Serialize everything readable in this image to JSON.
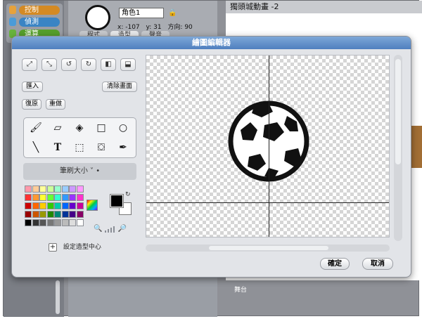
{
  "background": {
    "categories": [
      {
        "label": "控制",
        "color": "#e6a23c"
      },
      {
        "label": "偵測",
        "color": "#4b9bd8"
      },
      {
        "label": "運算",
        "color": "#68b43c"
      }
    ],
    "sprite_name": "角色1",
    "sprite_x": "x: -107",
    "sprite_y": "y: 31",
    "sprite_direction": "方向: 90",
    "tabs": [
      "程式",
      "造型",
      "聲音"
    ],
    "stage_title": "獨頭城動畫 -2",
    "stage_label": "舞台"
  },
  "editor": {
    "title": "繪圖編輯器",
    "import_label": "匯入",
    "clear_label": "清除畫面",
    "undo_label": "復原",
    "redo_label": "重做",
    "brush_size_label": "筆刷大小",
    "set_center_label": "設定造型中心",
    "ok_label": "確定",
    "cancel_label": "取消",
    "transform_icons": [
      "grow-icon",
      "shrink-icon",
      "rotate-left-icon",
      "rotate-right-icon",
      "flip-horizontal-icon",
      "flip-vertical-icon"
    ],
    "tools": [
      "paintbrush-icon",
      "eraser-icon",
      "fill-bucket-icon",
      "rectangle-icon",
      "ellipse-icon",
      "line-icon",
      "text-icon",
      "select-icon",
      "stamp-icon",
      "eyedropper-icon"
    ],
    "foreground_color": "#000000",
    "background_color": "#ffffff",
    "palette": [
      "#ff99aa",
      "#ffcc99",
      "#ffff99",
      "#ccff99",
      "#99ffcc",
      "#99ccff",
      "#cc99ff",
      "#ff99ff",
      "#ff3333",
      "#ff9933",
      "#ffff33",
      "#66ff33",
      "#33ffcc",
      "#3399ff",
      "#9933ff",
      "#ff33cc",
      "#cc0000",
      "#ff6600",
      "#ffcc00",
      "#33cc00",
      "#00ccaa",
      "#0066ff",
      "#6600cc",
      "#cc0099",
      "#990000",
      "#cc5500",
      "#999900",
      "#228800",
      "#008877",
      "#003399",
      "#440088",
      "#880066",
      "#000000",
      "#333333",
      "#555555",
      "#777777",
      "#999999",
      "#bbbbbb",
      "#dddddd",
      "#ffffff"
    ]
  }
}
